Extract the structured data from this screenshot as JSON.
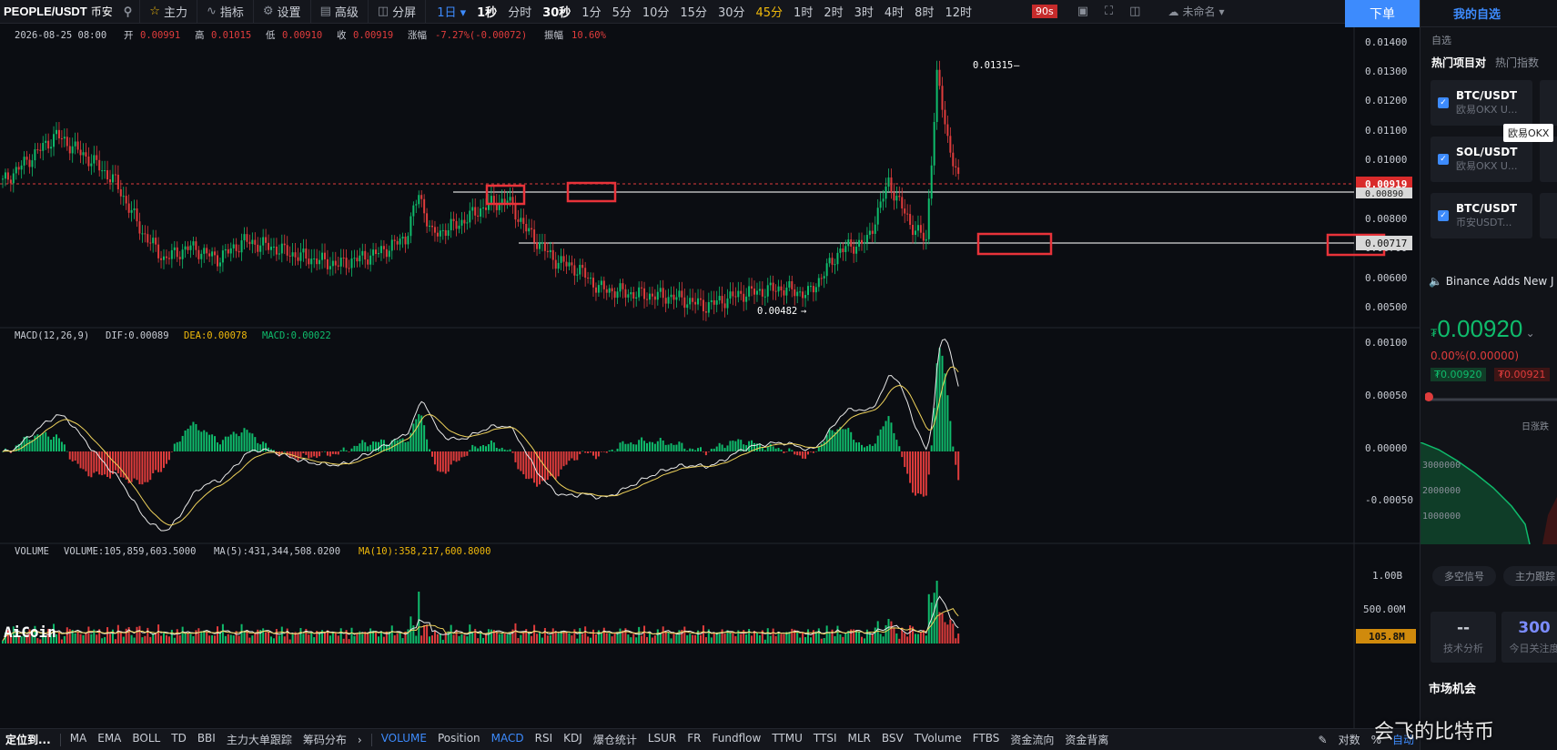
{
  "topbar": {
    "symbol": "PEOPLE/USDT",
    "exchange": "币安",
    "buttons": [
      {
        "icon": "star-icon",
        "label": "主力"
      },
      {
        "icon": "indicator-icon",
        "label": "指标"
      },
      {
        "icon": "gear-icon",
        "label": "设置"
      },
      {
        "icon": "advanced-icon",
        "label": "高级"
      },
      {
        "icon": "split-screen-icon",
        "label": "分屏"
      }
    ],
    "interval_selected": "1日",
    "intervals": [
      "1秒",
      "分时",
      "30秒",
      "1分",
      "5分",
      "10分",
      "15分",
      "30分",
      "45分",
      "1时",
      "2时",
      "3时",
      "4时",
      "8时",
      "12时"
    ],
    "countdown": "90s",
    "unnamed_label": "未命名",
    "order_button": "下单"
  },
  "ohlc_bar": {
    "datetime": "2026-08-25 08:00",
    "open_label": "开",
    "open": "0.00991",
    "high_label": "高",
    "high": "0.01015",
    "low_label": "低",
    "low": "0.00910",
    "close_label": "收",
    "close": "0.00919",
    "change_label": "涨幅",
    "change": "-7.27%(-0.00072)",
    "amplitude_label": "振幅",
    "amplitude": "10.60%"
  },
  "price_axis": [
    "0.01400",
    "0.01300",
    "0.01200",
    "0.01100",
    "0.01000",
    "0.00800",
    "0.00700",
    "0.00600",
    "0.00500"
  ],
  "price_tags": {
    "current": "0.00919",
    "line_upper": "0.00890",
    "line_lower": "0.00717"
  },
  "annotations": {
    "high_marker": "0.01315",
    "low_marker": "0.00482"
  },
  "macd": {
    "title": "MACD(12,26,9)",
    "dif": "DIF:0.00089",
    "dea": "DEA:0.00078",
    "macd": "MACD:0.00022",
    "axis": [
      "0.00100",
      "0.00050",
      "0.00000",
      "-0.00050"
    ]
  },
  "volume": {
    "title": "VOLUME",
    "volume": "VOLUME:105,859,603.5000",
    "ma5": "MA(5):431,344,508.0200",
    "ma10": "MA(10):358,217,600.8000",
    "axis": [
      "1.00B",
      "500.00M"
    ],
    "current_tag": "105.8M",
    "logo": "AiCoin"
  },
  "colors": {
    "up": "#0fbc6c",
    "down": "#e03c3c",
    "accent": "#3d8bfd",
    "highlight": "#f0b90b"
  },
  "right_panel": {
    "tab": "我的自选",
    "section": "自选",
    "subtabs": [
      "热门项目对",
      "热门指数"
    ],
    "cards": [
      {
        "pair": "BTC/USDT",
        "sub": "欧易OKX U..."
      },
      {
        "pair": "SOL/USDT",
        "sub": "欧易OKX U..."
      },
      {
        "pair": "BTC/USDT",
        "sub": "币安USDT..."
      }
    ],
    "tooltip": "欧易OKX",
    "news": "Binance Adds New J",
    "price": "0.00920",
    "currency_symbol": "₮",
    "pct": "0.00%(0.00000)",
    "bid": "₮0.00920",
    "ask": "₮0.00921",
    "day_range": "日涨跌",
    "depth_labels": [
      "3000000",
      "2000000",
      "1000000"
    ],
    "pills": [
      "多空信号",
      "主力跟踪"
    ],
    "stats": [
      {
        "value": "--",
        "label": "技术分析"
      },
      {
        "value": "300",
        "label": "今日关注度"
      }
    ],
    "market": "市场机会"
  },
  "bottombar": {
    "locate": "定位到...",
    "left_items": [
      "MA",
      "EMA",
      "BOLL",
      "TD",
      "BBI",
      "主力大单跟踪",
      "筹码分布"
    ],
    "right_items": [
      "VOLUME",
      "Position",
      "MACD",
      "RSI",
      "KDJ",
      "爆仓统计",
      "LSUR",
      "FR",
      "Fundflow",
      "TTMU",
      "TTSI",
      "MLR",
      "BSV",
      "TVolume",
      "FTBS",
      "资金流向",
      "资金背离"
    ],
    "active": [
      "VOLUME",
      "MACD"
    ],
    "end_items": [
      "对数",
      "%",
      "自动"
    ]
  },
  "watermark": "会飞的比特币"
}
